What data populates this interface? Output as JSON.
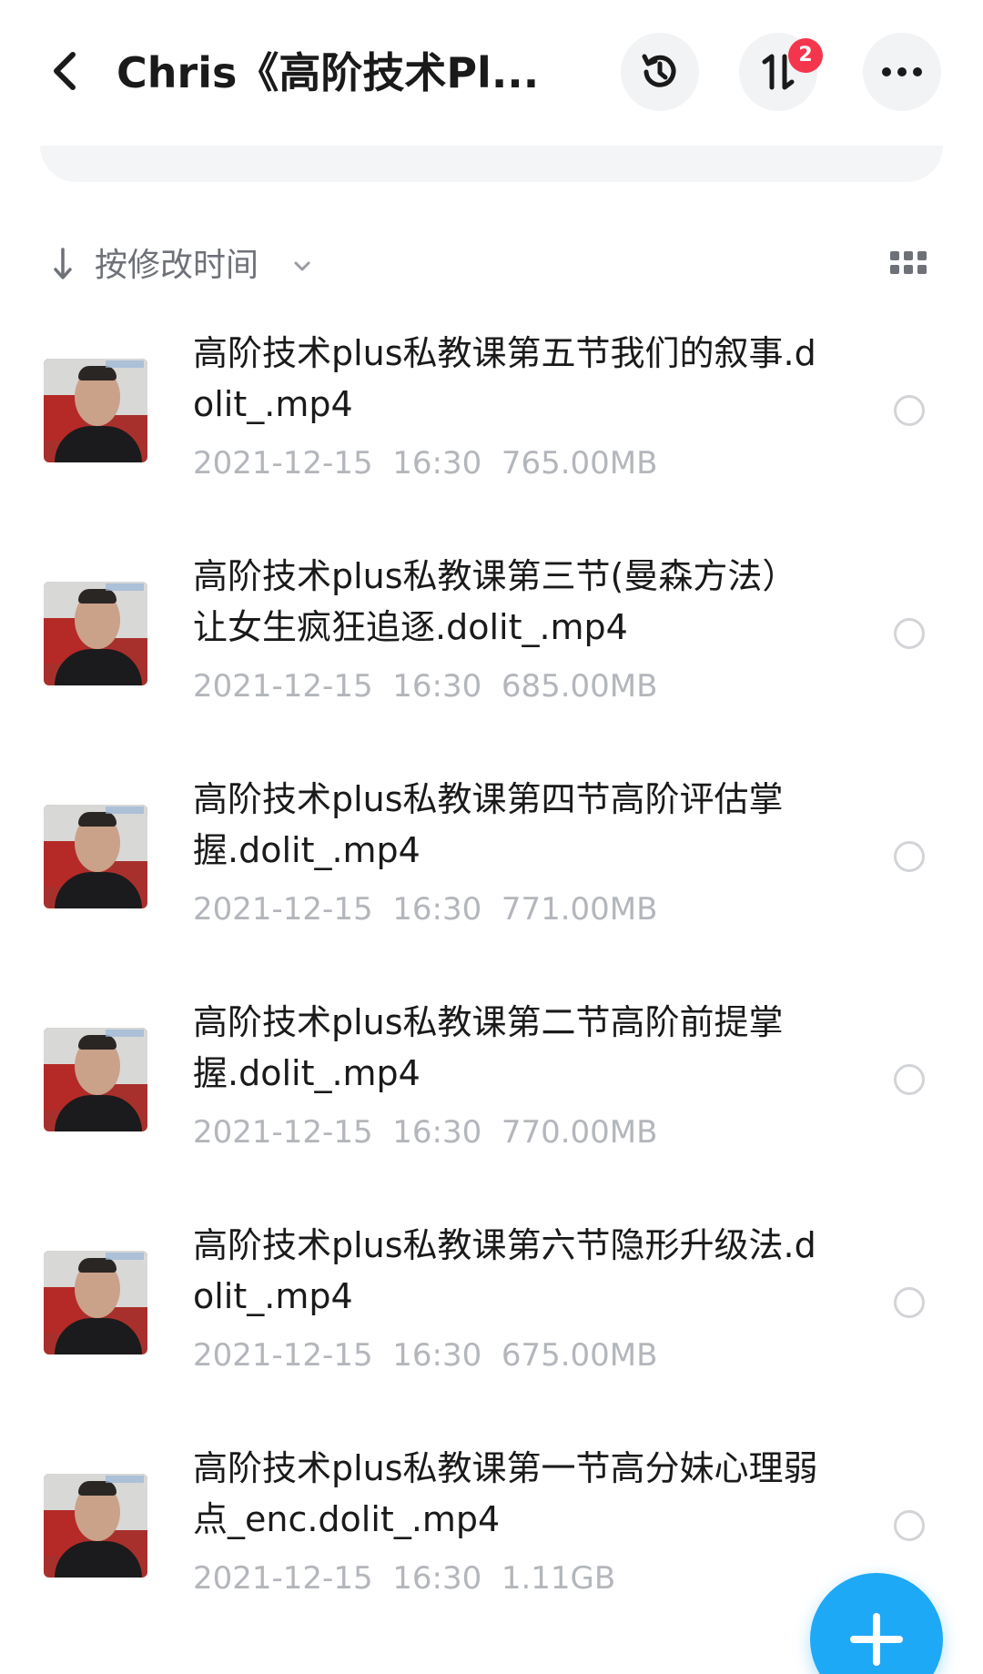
{
  "header": {
    "title": "Chris《高阶技术Pl...",
    "transfer_badge": "2"
  },
  "sort": {
    "label": "按修改时间"
  },
  "files": [
    {
      "name": "高阶技术plus私教课第五节我们的叙事.dolit_.mp4",
      "date": "2021-12-15",
      "time": "16:30",
      "size": "765.00MB"
    },
    {
      "name": "高阶技术plus私教课第三节(曼森方法）让女生疯狂追逐.dolit_.mp4",
      "date": "2021-12-15",
      "time": "16:30",
      "size": "685.00MB"
    },
    {
      "name": "高阶技术plus私教课第四节高阶评估掌握.dolit_.mp4",
      "date": "2021-12-15",
      "time": "16:30",
      "size": "771.00MB"
    },
    {
      "name": "高阶技术plus私教课第二节高阶前提掌握.dolit_.mp4",
      "date": "2021-12-15",
      "time": "16:30",
      "size": "770.00MB"
    },
    {
      "name": "高阶技术plus私教课第六节隐形升级法.dolit_.mp4",
      "date": "2021-12-15",
      "time": "16:30",
      "size": "675.00MB"
    },
    {
      "name": "高阶技术plus私教课第一节高分妹心理弱点_enc.dolit_.mp4",
      "date": "2021-12-15",
      "time": "16:30",
      "size": "1.11GB"
    }
  ],
  "colors": {
    "accent": "#1ea9f6",
    "badge": "#f4364c",
    "meta_text": "#b3b6bb"
  },
  "icons": {
    "back": "chevron-left-icon",
    "history": "history-clock-icon",
    "transfer": "transfer-arrows-icon",
    "more": "more-dots-icon",
    "sort": "sort-down-arrow-icon",
    "view": "grid-view-icon",
    "add": "plus-icon"
  }
}
